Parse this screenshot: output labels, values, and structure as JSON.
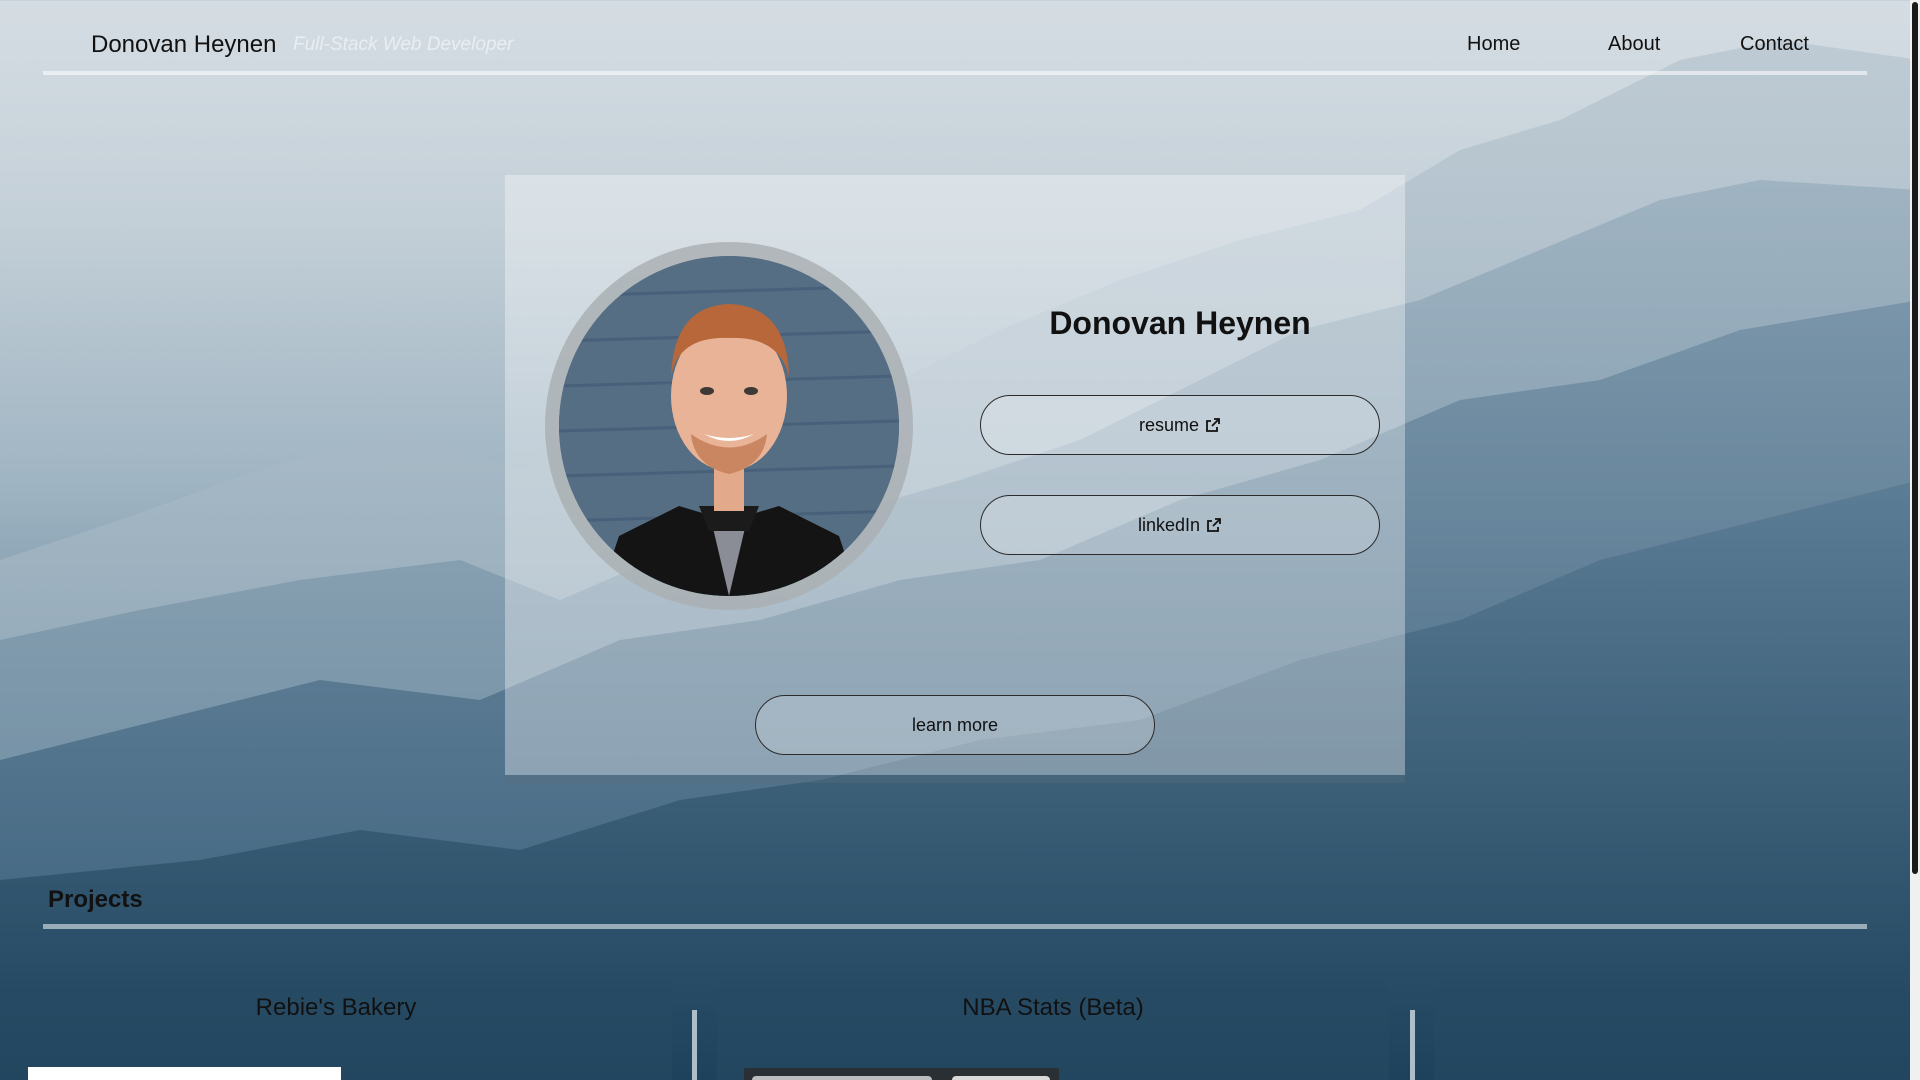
{
  "header": {
    "brand_name": "Donovan Heynen",
    "brand_tagline": "Full-Stack Web Developer",
    "nav": [
      {
        "label": "Home"
      },
      {
        "label": "About"
      },
      {
        "label": "Contact"
      }
    ]
  },
  "profile": {
    "name": "Donovan Heynen",
    "resume_label": "resume",
    "linkedin_label": "linkedIn",
    "learn_more_label": "learn more",
    "link_icon": "external-link-icon"
  },
  "projects": {
    "title": "Projects",
    "items": [
      {
        "title": "Rebie's Bakery"
      },
      {
        "title": "NBA Stats (Beta)"
      },
      {
        "title": ""
      }
    ]
  },
  "colors": {
    "sky": "#d5dde3",
    "mountain_dark": "#21465e",
    "text": "#111111",
    "tagline": "#e9eef2"
  }
}
